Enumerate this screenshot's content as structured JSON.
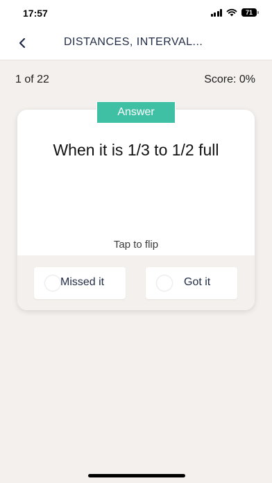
{
  "status_bar": {
    "time": "17:57",
    "battery": "71",
    "icons": [
      "cellular-signal-icon",
      "wifi-icon",
      "battery-icon"
    ]
  },
  "header": {
    "back_icon": "chevron-left-icon",
    "title": "DISTANCES, INTERVAL..."
  },
  "progress": {
    "count": "1 of 22",
    "score": "Score: 0%"
  },
  "card": {
    "badge": "Answer",
    "text": "When it is 1/3 to 1/2 full",
    "hint": "Tap to flip",
    "missed_label": "Missed it",
    "got_label": "Got it"
  },
  "colors": {
    "accent": "#3fbfa3",
    "background": "#f4f0ed",
    "title_text": "#1f2a44"
  }
}
